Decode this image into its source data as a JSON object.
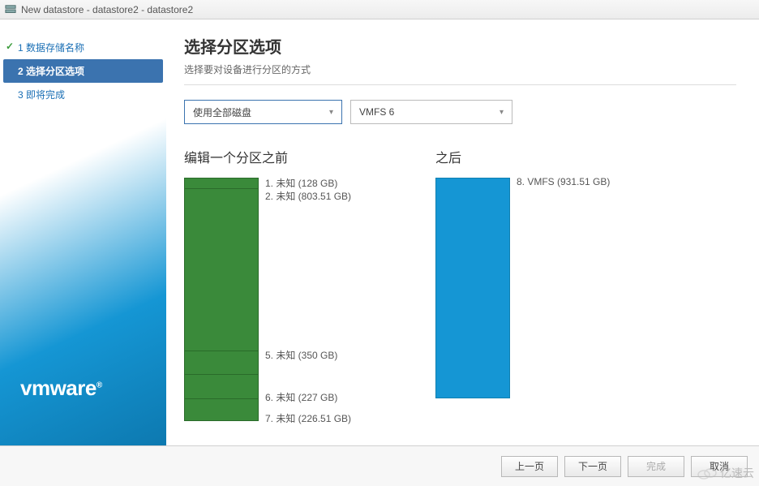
{
  "window": {
    "title": "New datastore - datastore2 - datastore2"
  },
  "steps": {
    "s1": "1 数据存储名称",
    "s2": "2 选择分区选项",
    "s3": "3 即将完成"
  },
  "logo": "vmware",
  "page": {
    "title": "选择分区选项",
    "subtitle": "选择要对设备进行分区的方式"
  },
  "selects": {
    "disk": "使用全部磁盘",
    "fs": "VMFS 6"
  },
  "before": {
    "title": "编辑一个分区之前",
    "p1": "1. 未知   (128 GB)",
    "p2": "2. 未知   (803.51 GB)",
    "p5": "5. 未知   (350 GB)",
    "p6": "6. 未知   (227 GB)",
    "p7": "7. 未知   (226.51 GB)"
  },
  "after": {
    "title": "之后",
    "p8": "8. VMFS   (931.51 GB)"
  },
  "buttons": {
    "prev": "上一页",
    "next": "下一页",
    "finish": "完成",
    "cancel": "取消"
  },
  "watermark": "亿速云",
  "chart_data": [
    {
      "type": "bar",
      "title": "编辑一个分区之前",
      "categories": [
        "1. 未知",
        "2. 未知",
        "5. 未知",
        "6. 未知",
        "7. 未知"
      ],
      "values": [
        128,
        803.51,
        350,
        227,
        226.51
      ],
      "ylabel": "GB",
      "ylim": [
        0,
        1735.02
      ]
    },
    {
      "type": "bar",
      "title": "之后",
      "categories": [
        "8. VMFS"
      ],
      "values": [
        931.51
      ],
      "ylabel": "GB",
      "ylim": [
        0,
        931.51
      ]
    }
  ]
}
